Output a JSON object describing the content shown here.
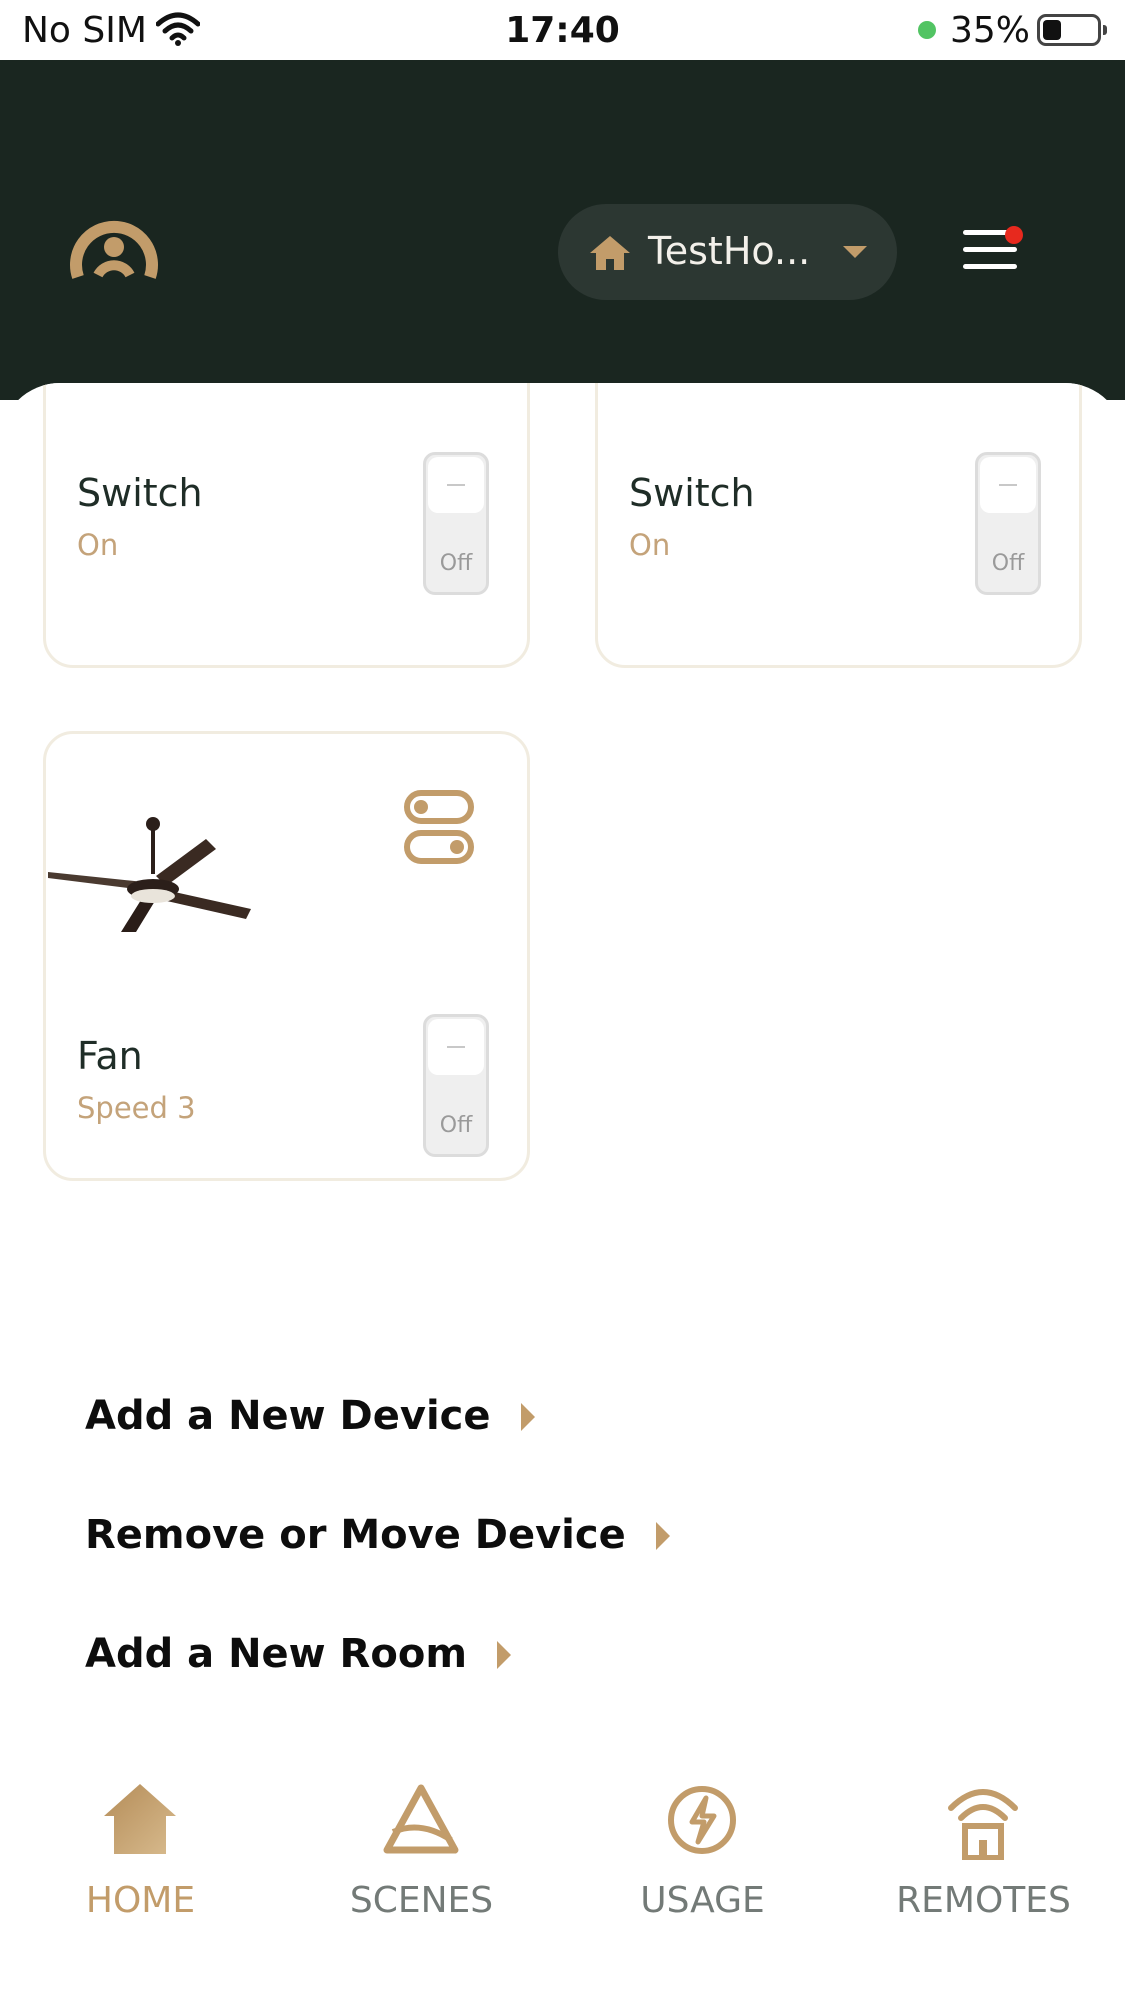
{
  "status_bar": {
    "carrier": "No SIM",
    "time": "17:40",
    "battery": "35%"
  },
  "header": {
    "home_name": "TestHo...",
    "notification": true
  },
  "devices": [
    {
      "name": "Switch",
      "status": "On",
      "toggle_label": "Off"
    },
    {
      "name": "Switch",
      "status": "On",
      "toggle_label": "Off"
    },
    {
      "name": "Fan",
      "status": "Speed 3",
      "toggle_label": "Off"
    }
  ],
  "actions": {
    "add_device": "Add a New Device",
    "remove_move_device": "Remove or Move Device",
    "add_room": "Add a New Room"
  },
  "tabs": [
    {
      "label": "HOME",
      "icon": "home-icon",
      "active": true
    },
    {
      "label": "SCENES",
      "icon": "scenes-icon",
      "active": false
    },
    {
      "label": "USAGE",
      "icon": "usage-icon",
      "active": false
    },
    {
      "label": "REMOTES",
      "icon": "remotes-icon",
      "active": false
    }
  ],
  "colors": {
    "header_bg": "#1a2620",
    "accent": "#c29c6a",
    "card_border": "#f1ece0",
    "inactive_tab": "#737a77",
    "badge": "#e7291e"
  }
}
